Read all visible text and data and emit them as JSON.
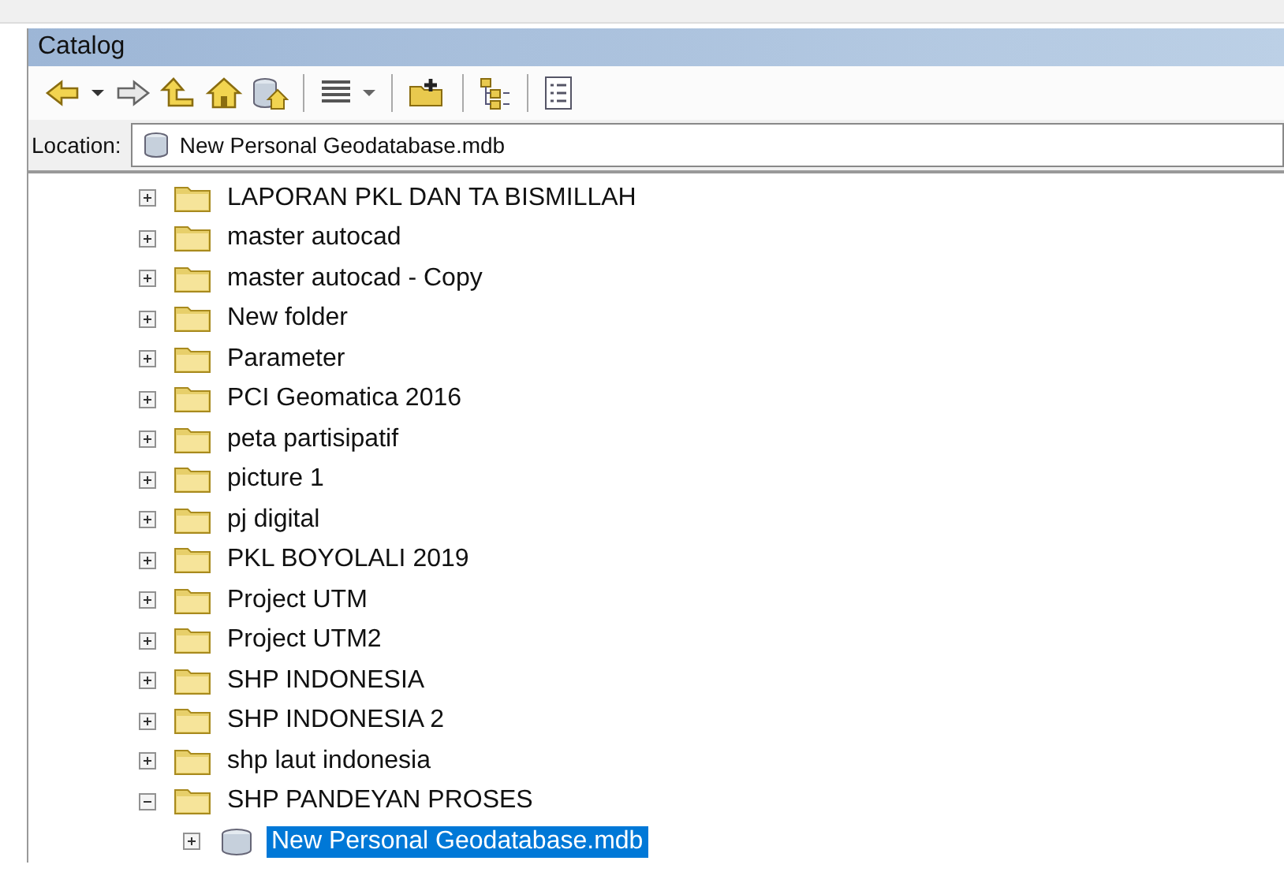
{
  "window": {
    "title": "Catalog"
  },
  "location": {
    "label": "Location:",
    "value": "New Personal Geodatabase.mdb"
  },
  "tree": [
    {
      "label": "LAPORAN PKL DAN TA BISMILLAH",
      "kind": "folder",
      "expanded": false,
      "selected": false
    },
    {
      "label": "master autocad",
      "kind": "folder",
      "expanded": false,
      "selected": false
    },
    {
      "label": "master autocad - Copy",
      "kind": "folder",
      "expanded": false,
      "selected": false
    },
    {
      "label": "New folder",
      "kind": "folder",
      "expanded": false,
      "selected": false
    },
    {
      "label": "Parameter",
      "kind": "folder",
      "expanded": false,
      "selected": false
    },
    {
      "label": "PCI Geomatica 2016",
      "kind": "folder",
      "expanded": false,
      "selected": false
    },
    {
      "label": "peta partisipatif",
      "kind": "folder",
      "expanded": false,
      "selected": false
    },
    {
      "label": "picture 1",
      "kind": "folder",
      "expanded": false,
      "selected": false
    },
    {
      "label": "pj digital",
      "kind": "folder",
      "expanded": false,
      "selected": false
    },
    {
      "label": "PKL BOYOLALI 2019",
      "kind": "folder",
      "expanded": false,
      "selected": false
    },
    {
      "label": "Project UTM",
      "kind": "folder",
      "expanded": false,
      "selected": false
    },
    {
      "label": "Project UTM2",
      "kind": "folder",
      "expanded": false,
      "selected": false
    },
    {
      "label": "SHP INDONESIA",
      "kind": "folder",
      "expanded": false,
      "selected": false
    },
    {
      "label": "SHP INDONESIA 2",
      "kind": "folder",
      "expanded": false,
      "selected": false
    },
    {
      "label": "shp laut indonesia",
      "kind": "folder",
      "expanded": false,
      "selected": false
    },
    {
      "label": "SHP PANDEYAN PROSES",
      "kind": "folder",
      "expanded": true,
      "selected": false,
      "children": [
        {
          "label": "New Personal Geodatabase.mdb",
          "kind": "database",
          "expanded": false,
          "selected": true
        }
      ]
    }
  ]
}
